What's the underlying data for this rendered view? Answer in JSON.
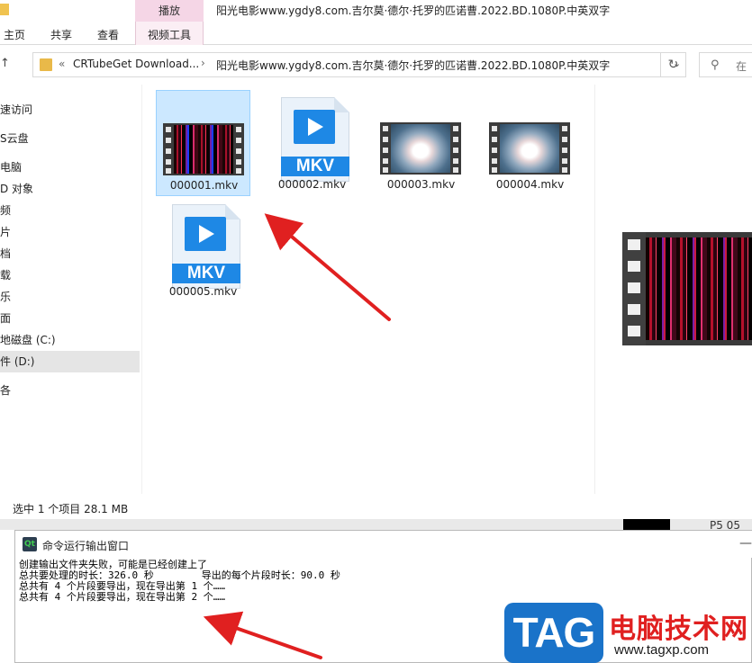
{
  "window": {
    "title": "阳光电影www.ygdy8.com.吉尔莫·德尔·托罗的匹诺曹.2022.BD.1080P.中英双字",
    "context_tab": "播放"
  },
  "ribbon": {
    "tabs": [
      "主页",
      "共享",
      "查看",
      "视频工具"
    ]
  },
  "address": {
    "breadcrumb_prefix": "«",
    "crumbs": [
      "CRTubeGet Download...",
      "阳光电影www.ygdy8.com.吉尔莫·德尔·托罗的匹诺曹.2022.BD.1080P.中英双字"
    ],
    "separator": "›",
    "search_placeholder": "在"
  },
  "navpane": {
    "items": [
      {
        "label": "速访问",
        "selected": false
      },
      {
        "label": "S云盘",
        "selected": false
      },
      {
        "label": "电脑",
        "selected": false
      },
      {
        "label": "D 对象",
        "selected": false
      },
      {
        "label": "频",
        "selected": false
      },
      {
        "label": "片",
        "selected": false
      },
      {
        "label": "档",
        "selected": false
      },
      {
        "label": "载",
        "selected": false
      },
      {
        "label": "乐",
        "selected": false
      },
      {
        "label": "面",
        "selected": false
      },
      {
        "label": "地磁盘 (C:)",
        "selected": false
      },
      {
        "label": "件 (D:)",
        "selected": true
      },
      {
        "label": "各",
        "selected": false
      }
    ]
  },
  "files": [
    {
      "name": "000001.mkv",
      "kind": "thumb-barcode",
      "selected": true
    },
    {
      "name": "000002.mkv",
      "kind": "mkv-icon",
      "selected": false
    },
    {
      "name": "000003.mkv",
      "kind": "thumb-sky",
      "selected": false
    },
    {
      "name": "000004.mkv",
      "kind": "thumb-sky",
      "selected": false
    },
    {
      "name": "000005.mkv",
      "kind": "mkv-icon",
      "selected": false
    }
  ],
  "mkv_label": "MKV",
  "status": {
    "text": "选中 1 个项目  28.1 MB"
  },
  "background_fragment": "P5  05",
  "console": {
    "title": "命令运行输出窗口",
    "icon_label": "Qt",
    "minimize": "—",
    "lines": [
      "创建输出文件夹失败，可能是已经创建上了",
      "总共要处理的时长：326.0 秒        导出的每个片段时长：90.0 秒",
      "总共有 4 个片段要导出，现在导出第 1 个……",
      "总共有 4 个片段要导出，现在导出第 2 个……"
    ]
  },
  "watermark": {
    "tag": "TAG",
    "cn": "电脑技术网",
    "url": "www.tagxp.com"
  },
  "colors": {
    "selection": "#cce8ff",
    "accent_blue": "#1e88e5",
    "arrow_red": "#e02020",
    "context_tab": "#f5d6e6"
  }
}
